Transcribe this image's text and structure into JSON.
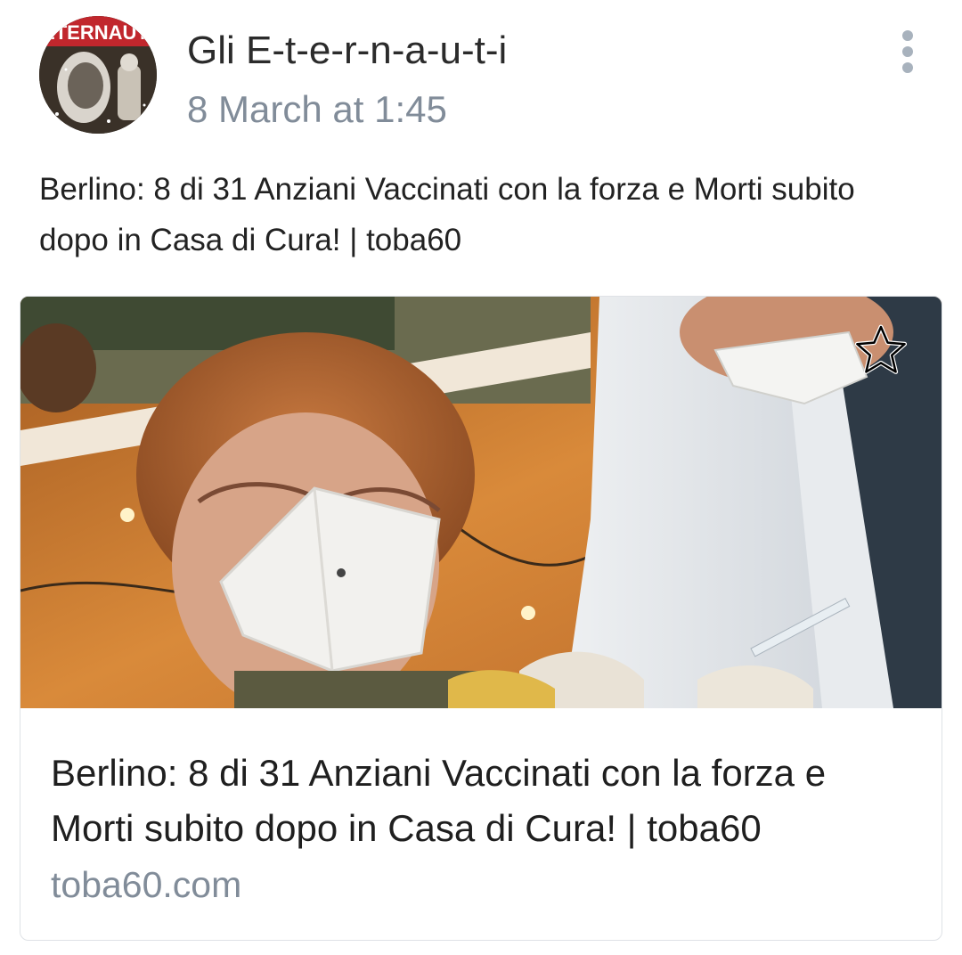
{
  "post": {
    "author": "Gli E-t-e-r-n-a-u-t-i",
    "date": "8 March at 1:45",
    "avatar_logo_text": "ETERNAUTI",
    "text": "Berlino: 8 di 31 Anziani Vaccinati con la forza e Morti subito dopo in Casa di Cura! | toba60",
    "more_icon": "more-vertical-icon"
  },
  "link_card": {
    "title": "Berlino: 8 di 31 Anziani Vaccinati con la forza e Morti subito dopo in Casa di Cura! | toba60",
    "domain": "toba60.com",
    "bookmark_icon": "star-outline-icon"
  },
  "colors": {
    "secondary_text": "#818c99",
    "primary_text": "#222222",
    "card_border": "#dfe2e6",
    "menu_dots": "#a8b2bd"
  }
}
